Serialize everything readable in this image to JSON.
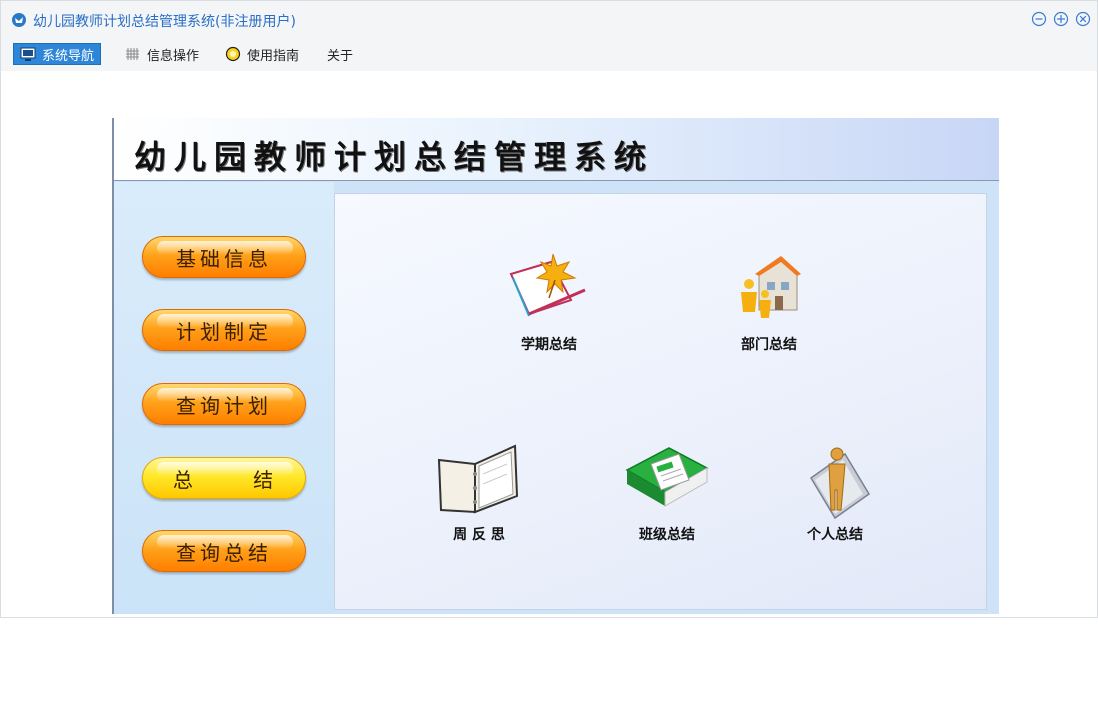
{
  "window": {
    "title": "幼儿园教师计划总结管理系统(非注册用户)"
  },
  "menu": {
    "items": [
      {
        "label": "系统导航",
        "active": true
      },
      {
        "label": "信息操作",
        "active": false
      },
      {
        "label": "使用指南",
        "active": false
      },
      {
        "label": "关于",
        "active": false
      }
    ]
  },
  "panel": {
    "title": "幼儿园教师计划总结管理系统"
  },
  "sidebar": {
    "buttons": [
      {
        "label": "基础信息"
      },
      {
        "label": "计划制定"
      },
      {
        "label": "查询计划"
      },
      {
        "label": "总 结"
      },
      {
        "label": "查询总结"
      }
    ]
  },
  "tiles": [
    {
      "label": "学期总结",
      "icon": "maple-book-icon"
    },
    {
      "label": "部门总结",
      "icon": "building-people-icon"
    },
    {
      "label": "周 反 思",
      "icon": "binder-icon"
    },
    {
      "label": "班级总结",
      "icon": "green-book-icon"
    },
    {
      "label": "个人总结",
      "icon": "person-icon"
    }
  ],
  "colors": {
    "accent": "#2e86d8",
    "title_text": "#2a6fc6",
    "nav_button": "#ff9a10",
    "nav_button_active": "#ffe82a"
  }
}
